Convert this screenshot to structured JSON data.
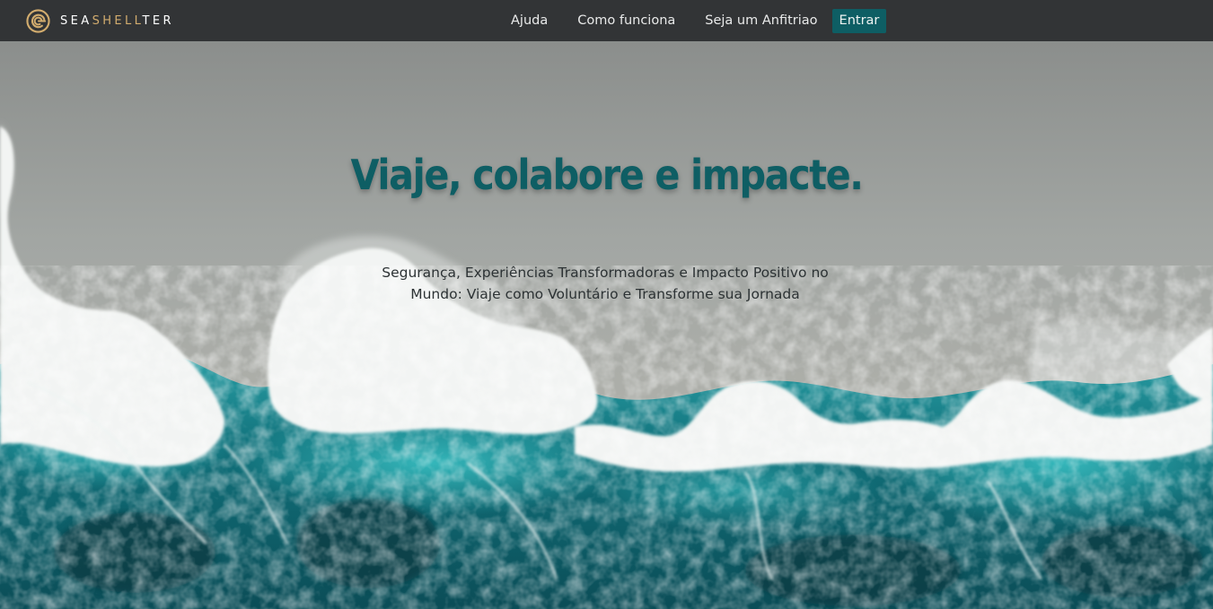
{
  "navbar": {
    "brand": {
      "part1": "SEA",
      "part2": "SHELL",
      "part3": "TER",
      "icon": "shell-logo-icon"
    },
    "links": [
      {
        "label": "Ajuda"
      },
      {
        "label": "Como funciona"
      },
      {
        "label": "Seja um Anfitriao"
      }
    ],
    "login_label": "Entrar"
  },
  "hero": {
    "title": "Viaje, colabore e impacte.",
    "subtitle": "Segurança, Experiências Transformadoras e Impacto Positivo no Mundo: Viaje como Voluntário e Transforme sua Jornada",
    "background": "aerial-ocean-waves-image"
  },
  "colors": {
    "navbar_bg": "#323436",
    "brand_gold": "#d2ac6e",
    "accent_teal": "#0e5e64",
    "subtitle_text": "#2c3234"
  }
}
